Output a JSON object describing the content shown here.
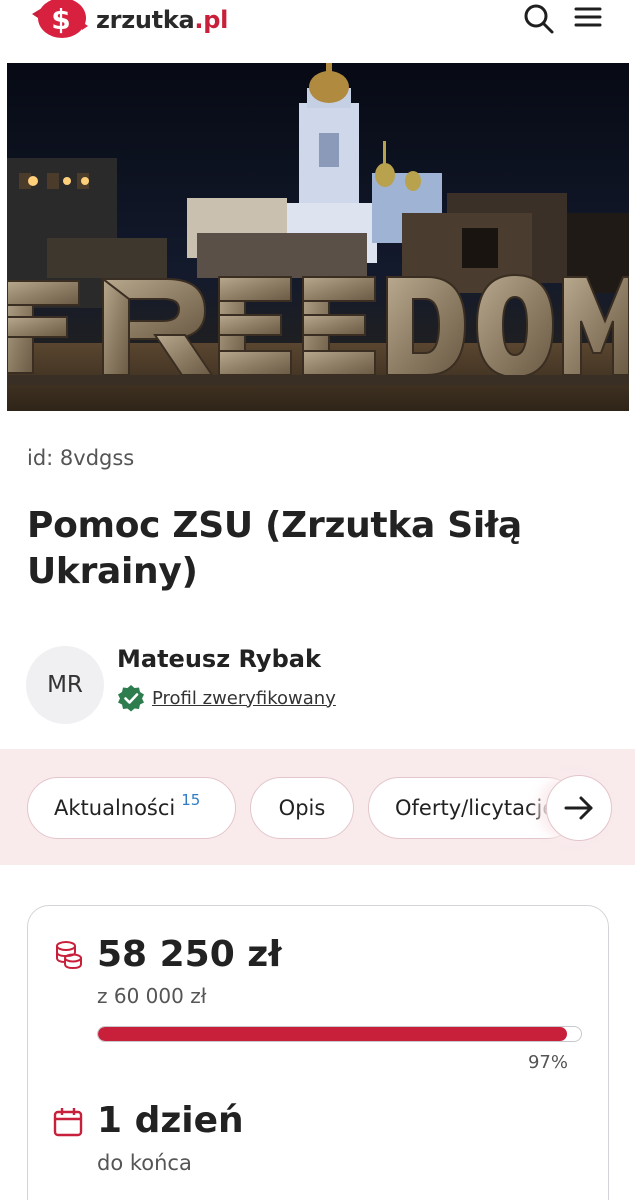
{
  "header": {
    "logo_text": "zrzutka",
    "logo_tld": ".pl",
    "icons": [
      "piggy-bank-logo-icon",
      "search-icon",
      "hamburger-menu-icon"
    ],
    "brand_color": "#c8203a"
  },
  "hero": {
    "image_text": "FREEDOM",
    "icon": "hero-photo"
  },
  "project": {
    "id_text": "id: 8vdgss",
    "title": "Pomoc ZSU (Zrzutka Siłą Ukrainy)"
  },
  "author": {
    "initials": "MR",
    "name": "Mateusz Rybak",
    "verified_label": "Profil zweryfikowany",
    "verified_color": "#2e7d4f"
  },
  "tabs": {
    "items": [
      {
        "label": "Aktualności",
        "badge": "15"
      },
      {
        "label": "Opis"
      },
      {
        "label": "Oferty/licytacje"
      }
    ],
    "next_icon": "arrow-right-icon"
  },
  "funding": {
    "raised": "58 250 zł",
    "goal": "z 60 000 zł",
    "progress_fraction": 0.97,
    "percent_label": "97%",
    "days_left": "1 dzień",
    "days_left_sub": "do końca",
    "icons": [
      "coins-icon",
      "calendar-icon"
    ]
  }
}
